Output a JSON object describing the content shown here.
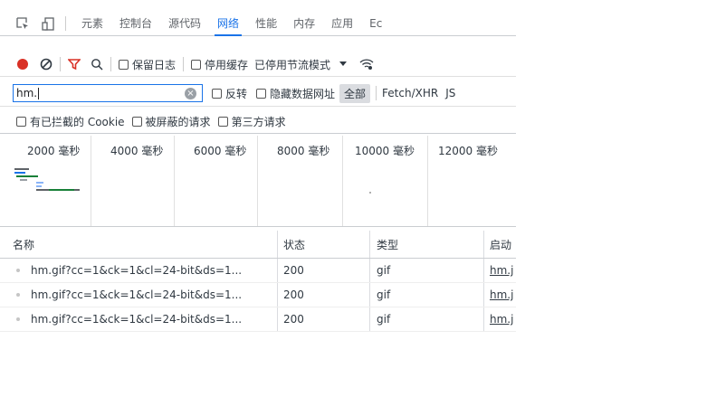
{
  "tabs": [
    {
      "label": "元素"
    },
    {
      "label": "控制台"
    },
    {
      "label": "源代码"
    },
    {
      "label": "网络",
      "active": true
    },
    {
      "label": "性能"
    },
    {
      "label": "内存"
    },
    {
      "label": "应用"
    },
    {
      "label": "Ec"
    }
  ],
  "toolbar": {
    "preserve_log": "保留日志",
    "disable_cache": "停用缓存",
    "throttling": "已停用节流模式"
  },
  "filter": {
    "value": "hm.",
    "invert": "反转",
    "hide_data_urls": "隐藏数据网址",
    "all": "全部",
    "fetch_xhr": "Fetch/XHR",
    "js": "JS"
  },
  "cookie_filters": {
    "blocked_cookies": "有已拦截的 Cookie",
    "blocked_requests": "被屏蔽的请求",
    "third_party": "第三方请求"
  },
  "timeline": {
    "ticks": [
      "2000 毫秒",
      "4000 毫秒",
      "6000 毫秒",
      "8000 毫秒",
      "10000 毫秒",
      "12000 毫秒"
    ]
  },
  "table": {
    "headers": {
      "name": "名称",
      "status": "状态",
      "type": "类型",
      "initiator": "启动"
    },
    "rows": [
      {
        "name": "hm.gif?cc=1&ck=1&cl=24-bit&ds=1...",
        "status": "200",
        "type": "gif",
        "initiator": "hm.j"
      },
      {
        "name": "hm.gif?cc=1&ck=1&cl=24-bit&ds=1...",
        "status": "200",
        "type": "gif",
        "initiator": "hm.j"
      },
      {
        "name": "hm.gif?cc=1&ck=1&cl=24-bit&ds=1...",
        "status": "200",
        "type": "gif",
        "initiator": "hm.j"
      }
    ]
  },
  "colors": {
    "accent": "#1a73e8",
    "record": "#d93025",
    "filter_icon": "#d93025"
  }
}
